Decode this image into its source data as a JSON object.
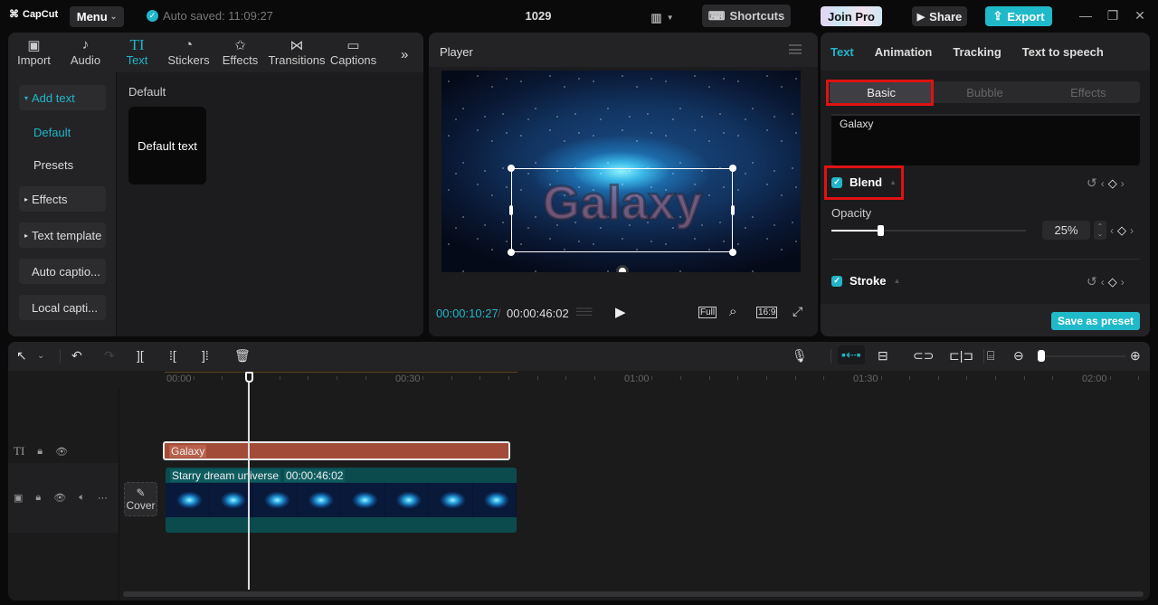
{
  "app": {
    "logo": "CapCut",
    "menu_label": "Menu",
    "autosave": "Auto saved: 11:09:27",
    "project_title": "1029",
    "shortcuts_label": "Shortcuts",
    "join_pro_label": "Join Pro",
    "share_label": "Share",
    "export_label": "Export"
  },
  "toolbar_tabs": [
    {
      "label": "Import",
      "icon": "import-icon"
    },
    {
      "label": "Audio",
      "icon": "audio-icon"
    },
    {
      "label": "Text",
      "icon": "text-icon",
      "active": true
    },
    {
      "label": "Stickers",
      "icon": "sticker-icon"
    },
    {
      "label": "Effects",
      "icon": "effects-icon"
    },
    {
      "label": "Transitions",
      "icon": "transitions-icon"
    },
    {
      "label": "Captions",
      "icon": "captions-icon"
    }
  ],
  "side_nav": {
    "add_text": "Add text",
    "default": "Default",
    "presets": "Presets",
    "effects": "Effects",
    "text_template": "Text template",
    "auto_captions": "Auto captio...",
    "local_captions": "Local capti..."
  },
  "content": {
    "section_label": "Default",
    "card_label": "Default text"
  },
  "player": {
    "title": "Player",
    "overlay_text": "Galaxy",
    "current_time": "00:00:10:27",
    "total_time": "00:00:46:02",
    "full_label": "Full",
    "ratio_label": "16:9"
  },
  "inspector": {
    "tabs": [
      "Text",
      "Animation",
      "Tracking",
      "Text to speech"
    ],
    "active_tab": "Text",
    "segments": [
      "Basic",
      "Bubble",
      "Effects"
    ],
    "active_segment": "Basic",
    "text_value": "Galaxy",
    "blend_label": "Blend",
    "blend_checked": true,
    "opacity_label": "Opacity",
    "opacity_value": "25%",
    "opacity_fraction": 0.25,
    "stroke_label": "Stroke",
    "stroke_checked": true,
    "save_preset_label": "Save as preset",
    "accent_color": "#20b9c9",
    "highlight_color": "#e01212"
  },
  "timeline": {
    "ruler": [
      "00:00",
      "00:30",
      "01:00",
      "01:30",
      "02:00"
    ],
    "text_clip": "Galaxy",
    "video_clip_name": "Starry dream universe",
    "video_clip_duration": "00:00:46:02",
    "cover_label": "Cover",
    "text_clip_color": "#a24b38",
    "video_clip_color": "#0b4b4e"
  }
}
